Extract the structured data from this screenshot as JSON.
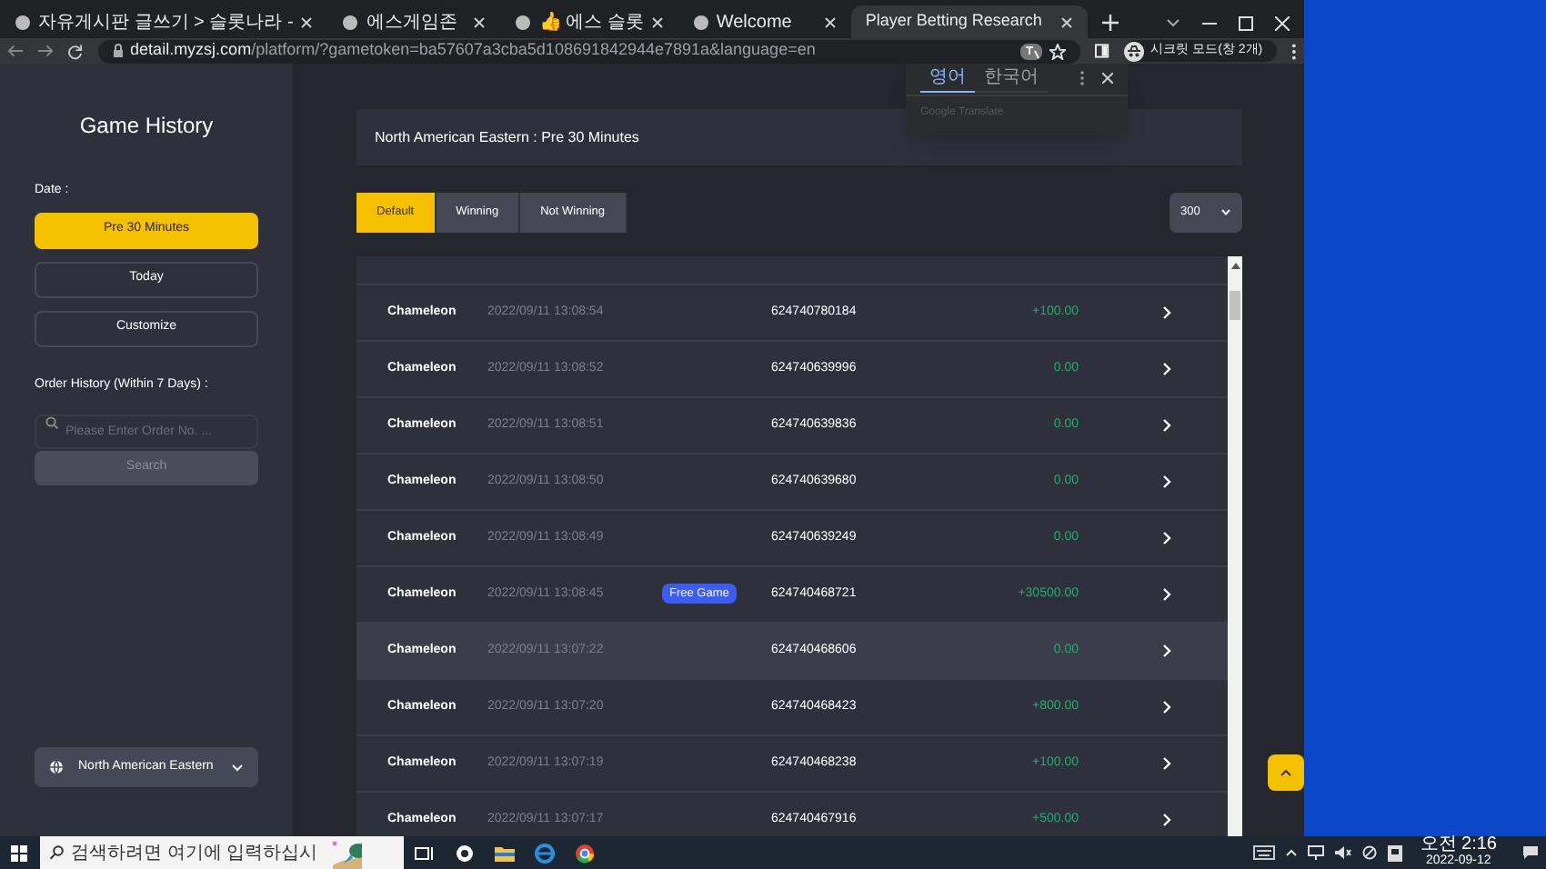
{
  "browser": {
    "tabs": [
      {
        "title": "자유게시판 글쓰기 > 슬롯나라 -",
        "selected": false
      },
      {
        "title": "에스게임존",
        "selected": false
      },
      {
        "title": "👍 에스 슬롯",
        "selected": false
      },
      {
        "title": "Welcome",
        "selected": false
      },
      {
        "title": "Player Betting Research",
        "selected": true
      }
    ],
    "url_host": "detail.myzsj.com",
    "url_path": "/platform/?gametoken=ba57607a3cba5d108691842944e7891a&language=en",
    "profile": "시크릿 모드(창 2개)"
  },
  "translate_popup": {
    "tabs": [
      {
        "label": "영어",
        "selected": true
      },
      {
        "label": "한국어",
        "selected": false
      }
    ],
    "footer": "Google Translate"
  },
  "sidebar": {
    "title": "Game History",
    "date_label": "Date :",
    "date_options": [
      {
        "label": "Pre 30 Minutes",
        "selected": true
      },
      {
        "label": "Today",
        "selected": false
      },
      {
        "label": "Customize",
        "selected": false
      }
    ],
    "order_label": "Order History (Within 7 Days) :",
    "order_placeholder": "Please Enter Order No. ...",
    "search_button": "Search",
    "region": "North American Eastern"
  },
  "header": "North American Eastern : Pre 30 Minutes",
  "filters": [
    {
      "label": "Default",
      "selected": true
    },
    {
      "label": "Winning",
      "selected": false
    },
    {
      "label": "Not Winning",
      "selected": false
    }
  ],
  "page_size": "300",
  "rows": [
    {
      "game": "Chameleon",
      "time": "2022/09/11 13:08:54",
      "order": "624740780184",
      "amount": "+100.00",
      "selected": false
    },
    {
      "game": "Chameleon",
      "time": "2022/09/11 13:08:52",
      "order": "624740639996",
      "amount": "0.00",
      "selected": false
    },
    {
      "game": "Chameleon",
      "time": "2022/09/11 13:08:51",
      "order": "624740639836",
      "amount": "0.00",
      "selected": false
    },
    {
      "game": "Chameleon",
      "time": "2022/09/11 13:08:50",
      "order": "624740639680",
      "amount": "0.00",
      "selected": false
    },
    {
      "game": "Chameleon",
      "time": "2022/09/11 13:08:49",
      "order": "624740639249",
      "amount": "0.00",
      "selected": false
    },
    {
      "game": "Chameleon",
      "time": "2022/09/11 13:08:45",
      "badge": "Free Game",
      "order": "624740468721",
      "amount": "+30500.00",
      "selected": false
    },
    {
      "game": "Chameleon",
      "time": "2022/09/11 13:07:22",
      "order": "624740468606",
      "amount": "0.00",
      "selected": true
    },
    {
      "game": "Chameleon",
      "time": "2022/09/11 13:07:20",
      "order": "624740468423",
      "amount": "+800.00",
      "selected": false
    },
    {
      "game": "Chameleon",
      "time": "2022/09/11 13:07:19",
      "order": "624740468238",
      "amount": "+100.00",
      "selected": false
    },
    {
      "game": "Chameleon",
      "time": "2022/09/11 13:07:17",
      "order": "624740467916",
      "amount": "+500.00",
      "selected": false
    }
  ],
  "taskbar": {
    "search_placeholder": "검색하려면 여기에 입력하십시",
    "clock_time": "오전 2:16",
    "clock_date": "2022-09-12"
  }
}
